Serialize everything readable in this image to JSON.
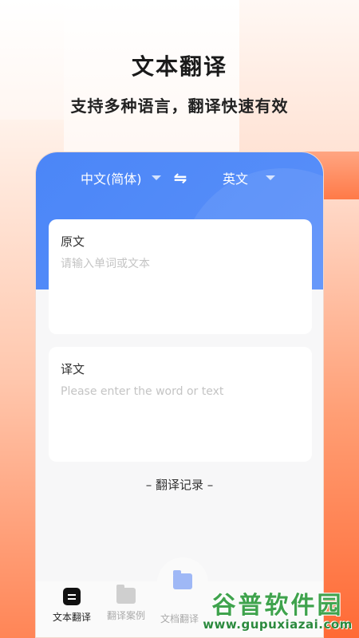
{
  "promo": {
    "headline": "文本翻译",
    "subline": "支持多种语言，翻译快速有效"
  },
  "lang_bar": {
    "source_lang": "中文(简体)",
    "swap_icon": "swap-arrows-icon",
    "target_lang": "英文"
  },
  "source_card": {
    "title": "原文",
    "placeholder": "请输入单词或文本",
    "value": ""
  },
  "target_card": {
    "title": "译文",
    "placeholder": "Please enter the word or text",
    "value": ""
  },
  "history": {
    "label": "– 翻译记录 –"
  },
  "tabbar": {
    "items": [
      {
        "label": "文本翻译",
        "icon": "text-doc-icon",
        "active": true
      },
      {
        "label": "翻译案例",
        "icon": "folder-icon",
        "active": false
      },
      {
        "label": "文档翻译",
        "icon": "folder-icon",
        "active": false
      }
    ]
  },
  "watermark": {
    "title": "谷普软件园",
    "url": "www.gupuxiazai.com"
  },
  "colors": {
    "header_blue": "#4b86f7",
    "accent_orange": "#ff6a35",
    "watermark_green": "#3fa34d"
  }
}
